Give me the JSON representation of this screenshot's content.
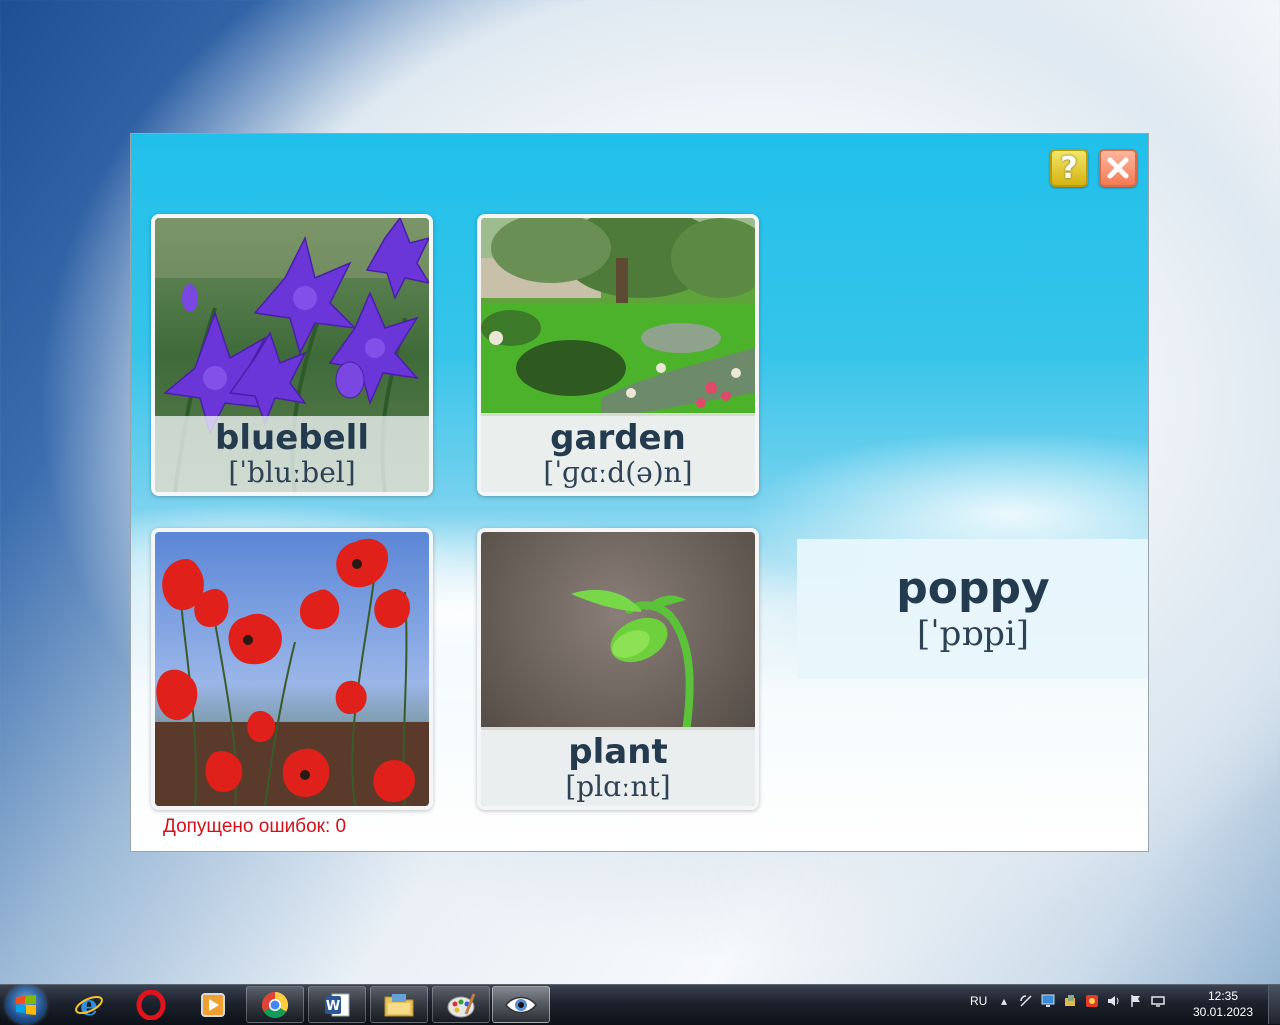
{
  "window": {
    "help_label": "?",
    "errors_text": "Допущено ошибок: 0"
  },
  "cards": [
    {
      "word": "bluebell",
      "transcription": "[ˈbluːbel]",
      "image": "bluebell-flowers-photo"
    },
    {
      "word": "garden",
      "transcription": "[ˈɡɑːd(ə)n]",
      "image": "garden-pond-photo"
    },
    {
      "word": "",
      "transcription": "",
      "image": "red-poppies-photo"
    },
    {
      "word": "plant",
      "transcription": "[plɑːnt]",
      "image": "sprouting-bean-photo"
    }
  ],
  "target": {
    "word": "poppy",
    "transcription": "[ˈpɒpi]"
  },
  "taskbar": {
    "apps": [
      "internet-explorer-icon",
      "opera-icon",
      "media-player-icon",
      "chrome-icon",
      "word-icon",
      "file-explorer-icon",
      "paint-icon",
      "eye-app-icon"
    ],
    "language": "RU",
    "time": "12:35",
    "date": "30.01.2023"
  },
  "colors": {
    "error_text": "#d4111b",
    "word_text": "#243b4f",
    "help_button": "#e3c92a",
    "close_button": "#f58c66"
  }
}
